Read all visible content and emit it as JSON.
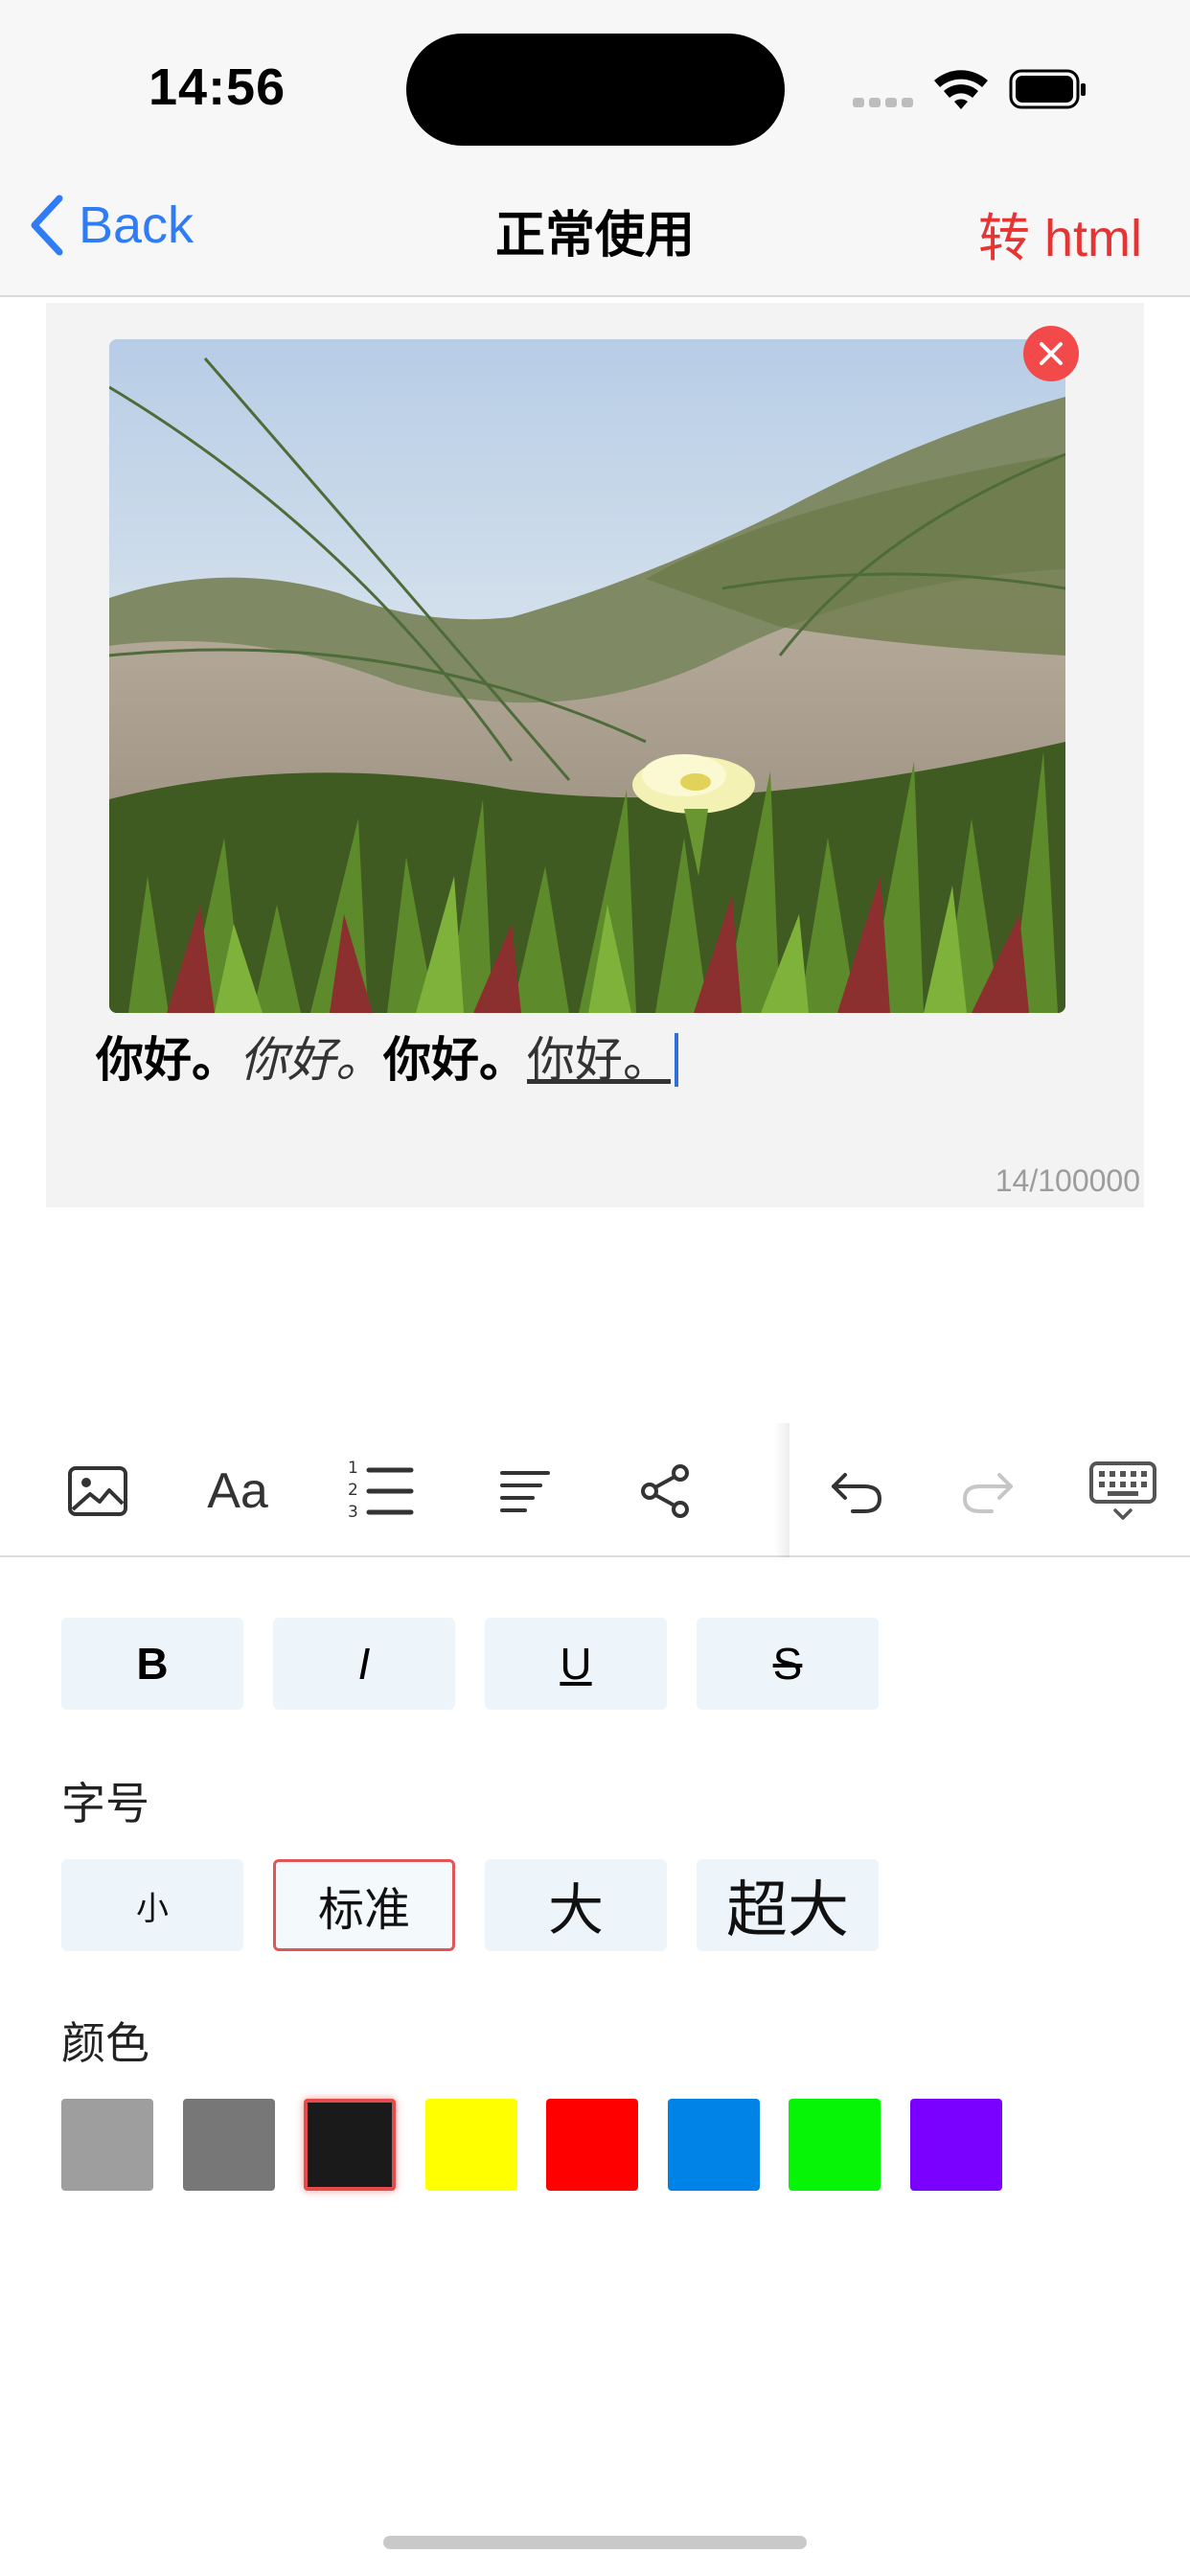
{
  "status_bar": {
    "time": "14:56"
  },
  "nav": {
    "back_label": "Back",
    "title": "正常使用",
    "action_label": "转 html"
  },
  "editor": {
    "segments": [
      {
        "style": "bold",
        "text": "你好。"
      },
      {
        "style": "italic",
        "text": "你好。"
      },
      {
        "style": "bold",
        "text": "你好。"
      },
      {
        "style": "underline",
        "text": "你好。"
      }
    ],
    "counter": "14/100000"
  },
  "toolbar": {
    "items": [
      "image-icon",
      "font-icon",
      "numbered-list-icon",
      "align-left-icon",
      "share-icon",
      "undo-icon",
      "redo-icon",
      "keyboard-dismiss-icon"
    ],
    "font_label": "Aa",
    "list_numbers": [
      "1",
      "2",
      "3"
    ],
    "redo_enabled": false
  },
  "format": {
    "styles": [
      {
        "label": "B",
        "style": "bold"
      },
      {
        "label": "I",
        "style": "italic"
      },
      {
        "label": "U",
        "style": "underline"
      },
      {
        "label": "S",
        "style": "strikethrough"
      }
    ],
    "size_label": "字号",
    "sizes": [
      {
        "label": "小",
        "selected": false
      },
      {
        "label": "标准",
        "selected": true
      },
      {
        "label": "大",
        "selected": false
      },
      {
        "label": "超大",
        "selected": false
      }
    ],
    "color_label": "颜色",
    "colors": [
      {
        "hex": "#9e9e9e",
        "selected": false
      },
      {
        "hex": "#777777",
        "selected": false
      },
      {
        "hex": "#1a1a1a",
        "selected": true
      },
      {
        "hex": "#ffff00",
        "selected": false
      },
      {
        "hex": "#ff0000",
        "selected": false
      },
      {
        "hex": "#0083e6",
        "selected": false
      },
      {
        "hex": "#06f406",
        "selected": false
      },
      {
        "hex": "#7a00ff",
        "selected": false
      }
    ]
  },
  "accent_colors": {
    "back": "#2f7cf6",
    "action": "#e53434",
    "selection": "#e05555"
  }
}
